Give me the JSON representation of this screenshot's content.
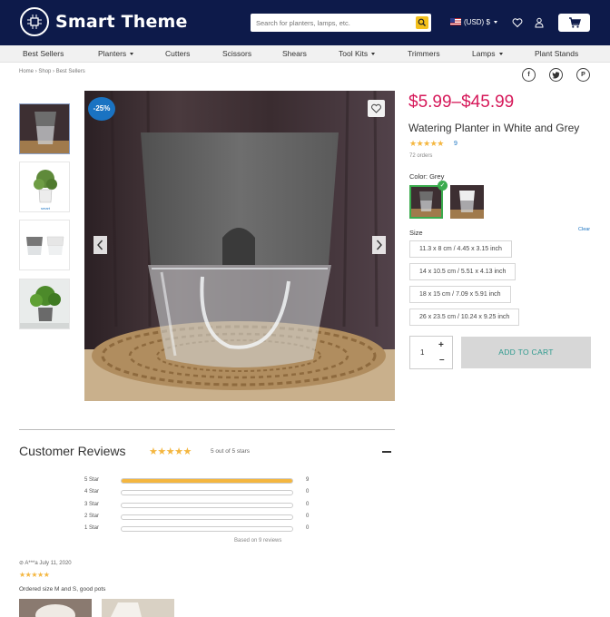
{
  "header": {
    "brand": "Smart Theme",
    "search_placeholder": "Search for planters, lamps, etc.",
    "currency": "(USD) $"
  },
  "nav": {
    "items": [
      {
        "label": "Best Sellers",
        "dropdown": false
      },
      {
        "label": "Planters",
        "dropdown": true
      },
      {
        "label": "Cutters",
        "dropdown": false
      },
      {
        "label": "Scissors",
        "dropdown": false
      },
      {
        "label": "Shears",
        "dropdown": false
      },
      {
        "label": "Tool Kits",
        "dropdown": true
      },
      {
        "label": "Trimmers",
        "dropdown": false
      },
      {
        "label": "Lamps",
        "dropdown": true
      },
      {
        "label": "Plant Stands",
        "dropdown": false
      }
    ]
  },
  "breadcrumb": [
    "Home",
    "Shop",
    "Best Sellers"
  ],
  "share": {
    "icons": [
      "facebook-icon",
      "twitter-icon",
      "pinterest-icon"
    ]
  },
  "gallery": {
    "discount": "-25%",
    "thumbnail_count": 4,
    "selected_thumbnail": 1
  },
  "product": {
    "price": "$5.99–$45.99",
    "title": "Watering Planter in White and Grey",
    "rating_stars": 5,
    "review_count": "9",
    "orders": "72 orders",
    "color_label": "Color: Grey",
    "colors": [
      "Grey",
      "White"
    ],
    "selected_color": "Grey",
    "size_label": "Size",
    "clear_label": "Clear",
    "sizes": [
      "11.3 x 8 cm / 4.45 x 3.15 inch",
      "14 x 10.5 cm / 5.51 x 4.13 inch",
      "18 x 15 cm / 7.09 x 5.91 inch",
      "26 x 23.5 cm / 10.24 x 9.25 inch"
    ],
    "quantity": "1",
    "add_to_cart": "ADD TO CART"
  },
  "reviews": {
    "title": "Customer Reviews",
    "summary": "5 out of 5 stars",
    "breakdown": [
      {
        "label": "5 Star",
        "count": "9",
        "fraction": 1.0
      },
      {
        "label": "4 Star",
        "count": "0",
        "fraction": 0
      },
      {
        "label": "3 Star",
        "count": "0",
        "fraction": 0
      },
      {
        "label": "2 Star",
        "count": "0",
        "fraction": 0
      },
      {
        "label": "1 Star",
        "count": "0",
        "fraction": 0
      }
    ],
    "based_on": "Based on 9 reviews",
    "first_review": {
      "author": "A***a",
      "date": "July 11, 2020",
      "stars": 5,
      "text": "Ordered size M and S, good pots"
    }
  },
  "colors": {
    "header_bg": "#0d1a4a",
    "price": "#d6195a",
    "star": "#f4b63f",
    "accent_blue": "#1a73c2",
    "selected_green": "#3aab4d",
    "search_button": "#f4c01c"
  }
}
